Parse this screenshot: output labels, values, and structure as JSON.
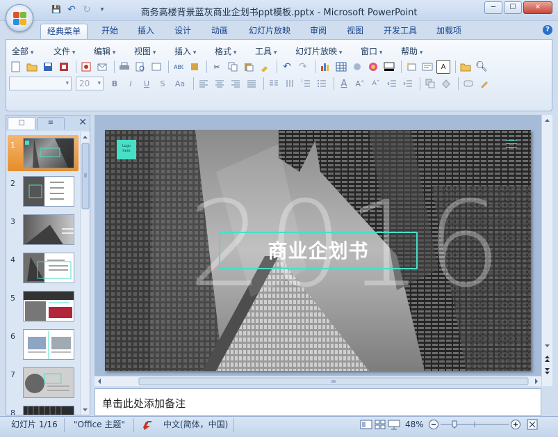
{
  "window": {
    "title": "商务高楼背景蓝灰商业企划书ppt模板.pptx - Microsoft PowerPoint",
    "minimize": "─",
    "maximize": "☐",
    "close": "✕"
  },
  "quick_access": {
    "save": "💾",
    "undo": "↶",
    "redo": "↻",
    "customize": "▾"
  },
  "ribbon_tabs": [
    "经典菜单",
    "开始",
    "插入",
    "设计",
    "动画",
    "幻灯片放映",
    "审阅",
    "视图",
    "开发工具",
    "加载项"
  ],
  "help": "?",
  "menu_items": [
    "全部",
    "文件",
    "编辑",
    "视图",
    "插入",
    "格式",
    "工具",
    "幻灯片放映",
    "窗口",
    "帮助"
  ],
  "font": {
    "name": "",
    "size": "20"
  },
  "format_buttons": {
    "bold": "B",
    "italic": "I",
    "underline": "U",
    "shadow": "S",
    "case": "Aa"
  },
  "left_panel": {
    "tab_slides": "▢",
    "tab_outline": "≡",
    "close": "✕",
    "slides": [
      "1",
      "2",
      "3",
      "4",
      "5",
      "6",
      "7",
      "8"
    ]
  },
  "slide": {
    "logo_line1": "Logo",
    "logo_line2": "here",
    "big_year": "2016",
    "title": "商业企划书"
  },
  "notes_placeholder": "单击此处添加备注",
  "status": {
    "slide_info": "幻灯片 1/16",
    "theme": "\"Office 主题\"",
    "language": "中文(简体，中国)",
    "zoom": "48%"
  },
  "colors": {
    "accent": "#46e0c8",
    "selected_thumb": "#e58d2a",
    "ribbon_text": "#15428b"
  }
}
